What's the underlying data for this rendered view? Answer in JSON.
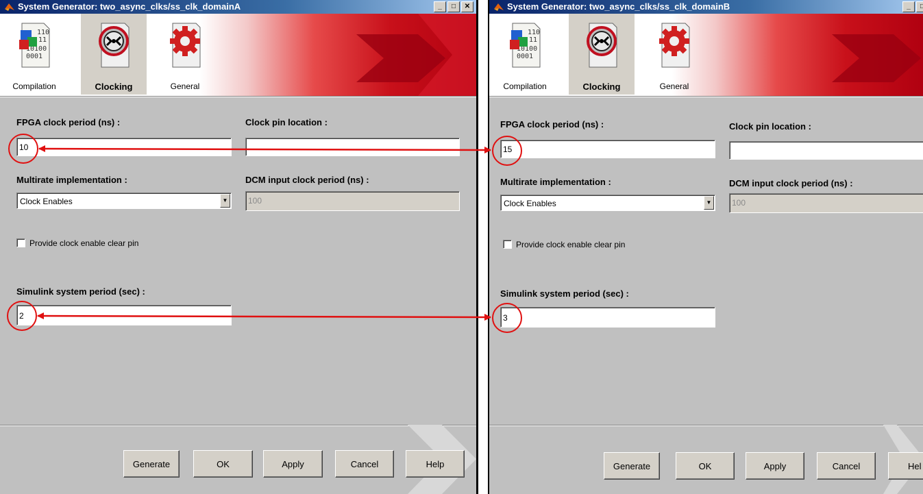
{
  "winA": {
    "title": "System Generator: two_async_clks/ss_clk_domainA",
    "tabs": [
      "Compilation",
      "Clocking",
      "General"
    ],
    "fpga_label": "FPGA clock period (ns) :",
    "fpga_value": "10",
    "pin_label": "Clock pin location :",
    "pin_value": "",
    "multirate_label": "Multirate implementation :",
    "multirate_value": "Clock Enables",
    "dcm_label": "DCM input clock period (ns) :",
    "dcm_value": "100",
    "clear_pin_label": "Provide clock enable clear pin",
    "simulink_label": "Simulink system period (sec) :",
    "simulink_value": "2",
    "buttons": [
      "Generate",
      "OK",
      "Apply",
      "Cancel",
      "Help"
    ]
  },
  "winB": {
    "title": "System Generator: two_async_clks/ss_clk_domainB",
    "tabs": [
      "Compilation",
      "Clocking",
      "General"
    ],
    "fpga_label": "FPGA clock period (ns) :",
    "fpga_value": "15",
    "pin_label": "Clock pin location :",
    "pin_value": "",
    "multirate_label": "Multirate implementation :",
    "multirate_value": "Clock Enables",
    "dcm_label": "DCM input clock period (ns) :",
    "dcm_value": "100",
    "clear_pin_label": "Provide clock enable clear pin",
    "simulink_label": "Simulink system period (sec) :",
    "simulink_value": "3",
    "buttons": [
      "Generate",
      "OK",
      "Apply",
      "Cancel",
      "Hel"
    ]
  },
  "icons": [
    "matlab-icon",
    "compilation-icon",
    "clocking-icon",
    "general-icon",
    "minimize-icon",
    "maximize-icon",
    "close-icon",
    "dropdown-arrow-icon"
  ],
  "colors": {
    "annotation": "#e01010",
    "title_bar": "#0a246a",
    "banner_red": "#c8101a"
  }
}
